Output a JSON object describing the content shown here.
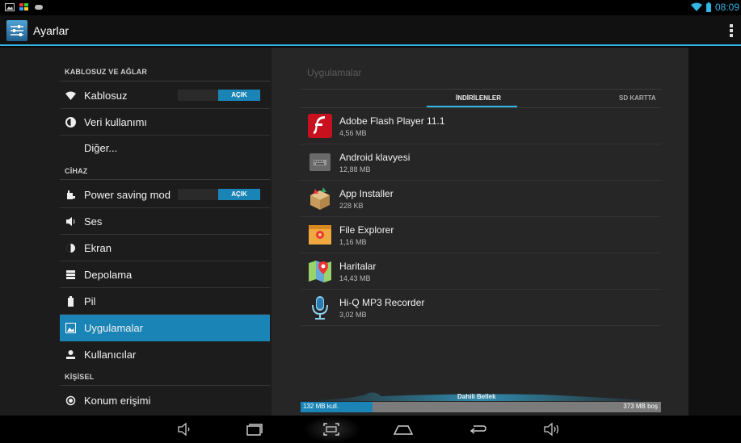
{
  "status_bar": {
    "time": "08:09"
  },
  "action_bar": {
    "title": "Ayarlar"
  },
  "sidebar": {
    "sections": [
      {
        "label": "KABLOSUZ VE AĞLAR"
      },
      {
        "label": "CİHAZ"
      },
      {
        "label": "KİŞİSEL"
      }
    ],
    "items": [
      {
        "label": "Kablosuz",
        "toggle": "AÇIK"
      },
      {
        "label": "Veri kullanımı"
      },
      {
        "label": "Diğer..."
      },
      {
        "label": "Power saving mod",
        "toggle": "AÇIK"
      },
      {
        "label": "Ses"
      },
      {
        "label": "Ekran"
      },
      {
        "label": "Depolama"
      },
      {
        "label": "Pil"
      },
      {
        "label": "Uygulamalar",
        "selected": true
      },
      {
        "label": "Kullanıcılar"
      },
      {
        "label": "Konum erişimi"
      }
    ]
  },
  "apps_panel": {
    "title": "Uygulamalar",
    "tabs": [
      {
        "label": "İNDİRİLENLER",
        "active": true
      },
      {
        "label": "SD KARTTA"
      }
    ],
    "apps": [
      {
        "name": "Adobe Flash Player 11.1",
        "size": "4,56 MB",
        "icon": "flash-icon"
      },
      {
        "name": "Android klavyesi",
        "size": "12,88 MB",
        "icon": "keyboard-icon"
      },
      {
        "name": "App Installer",
        "size": "228 KB",
        "icon": "installer-icon"
      },
      {
        "name": "File Explorer",
        "size": "1,16 MB",
        "icon": "folder-icon"
      },
      {
        "name": "Haritalar",
        "size": "14,43 MB",
        "icon": "map-icon"
      },
      {
        "name": "Hi-Q MP3 Recorder",
        "size": "3,02 MB",
        "icon": "microphone-icon"
      }
    ],
    "storage": {
      "label": "Dahili Bellek",
      "used_text": "132 MB kull.",
      "free_text": "373 MB boş",
      "used_fraction": 0.2
    }
  },
  "colors": {
    "accent": "#33b5e5",
    "selected": "#1b84b6"
  }
}
